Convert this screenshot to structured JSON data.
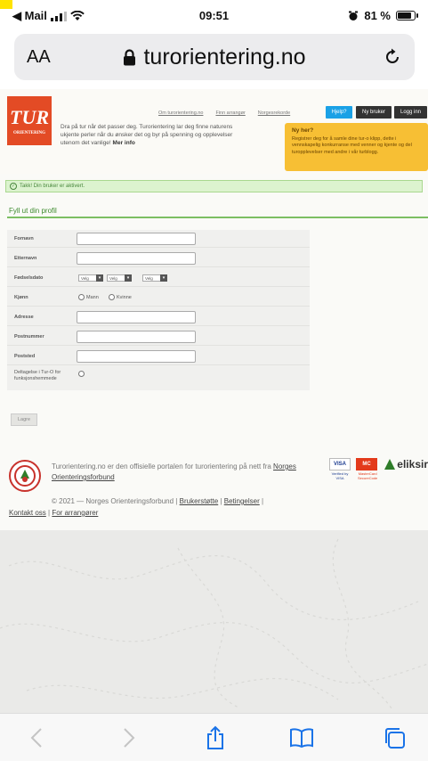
{
  "status_bar": {
    "back_app": "◀ Mail",
    "time": "09:51",
    "battery_pct": "81 %",
    "battery_level": 0.81
  },
  "address_bar": {
    "aa_label": "AA",
    "url": "turorientering.no"
  },
  "site": {
    "logo_text": "TUR",
    "logo_sub": "ORIENTERING",
    "intro_text": "Dra på tur når det passer deg. Turorientering lar deg finne naturens ukjente perler når du ønsker det og byr på spenning og opplevelser utenom det vanlige!",
    "intro_more": "Mer info",
    "top_links": [
      "Om turorientering.no",
      "Finn arrangør",
      "Norgesrekorde"
    ],
    "help_button": "Hjelp?",
    "new_user_button": "Ny bruker",
    "login_button": "Logg inn",
    "ny_her_title": "Ny her?",
    "ny_her_text": "Registrer deg for å samle dine tur-o klipp, dette i vennskapelig konkurranse med venner og kjente og del turopplevelser med andre i vår turblogg."
  },
  "alert": {
    "text": "Takk! Din bruker er aktivert."
  },
  "profile": {
    "heading": "Fyll ut din profil",
    "fields": {
      "fornavn": "Fornavn",
      "etternavn": "Etternavn",
      "fodselsdato": "Fødselsdato",
      "kjonn": "Kjønn",
      "adresse": "Adresse",
      "postnummer": "Postnummer",
      "poststed": "Poststed",
      "deltagelse": "Deltagelse i Tur-O for funksjonshemmede"
    },
    "date_selects": [
      "Velg",
      "Velg",
      "Velg"
    ],
    "gender_options": [
      "Mann",
      "Kvinne"
    ],
    "save_button": "Lagre"
  },
  "footer": {
    "text": "Turorientering.no er den offisielle portalen for turorientering på nett fra",
    "link_nof": "Norges Orienteringsforbund",
    "copyright": "© 2021 — Norges Orienteringsforbund |",
    "link_support": "Brukerstøtte",
    "link_terms": "Betingelser",
    "link_contact": "Kontakt oss",
    "link_organizer": "For arrangører",
    "payment_visa": "VISA",
    "payment_verified": "Verified by VISA",
    "payment_mc": "MC",
    "payment_securecode": "MasterCard SecureCode",
    "payment_eliksir": "eliksir"
  },
  "icons": {
    "back": "chevron-left-icon",
    "forward": "chevron-right-icon",
    "share": "share-icon",
    "bookmarks": "book-icon",
    "tabs": "tabs-icon"
  }
}
